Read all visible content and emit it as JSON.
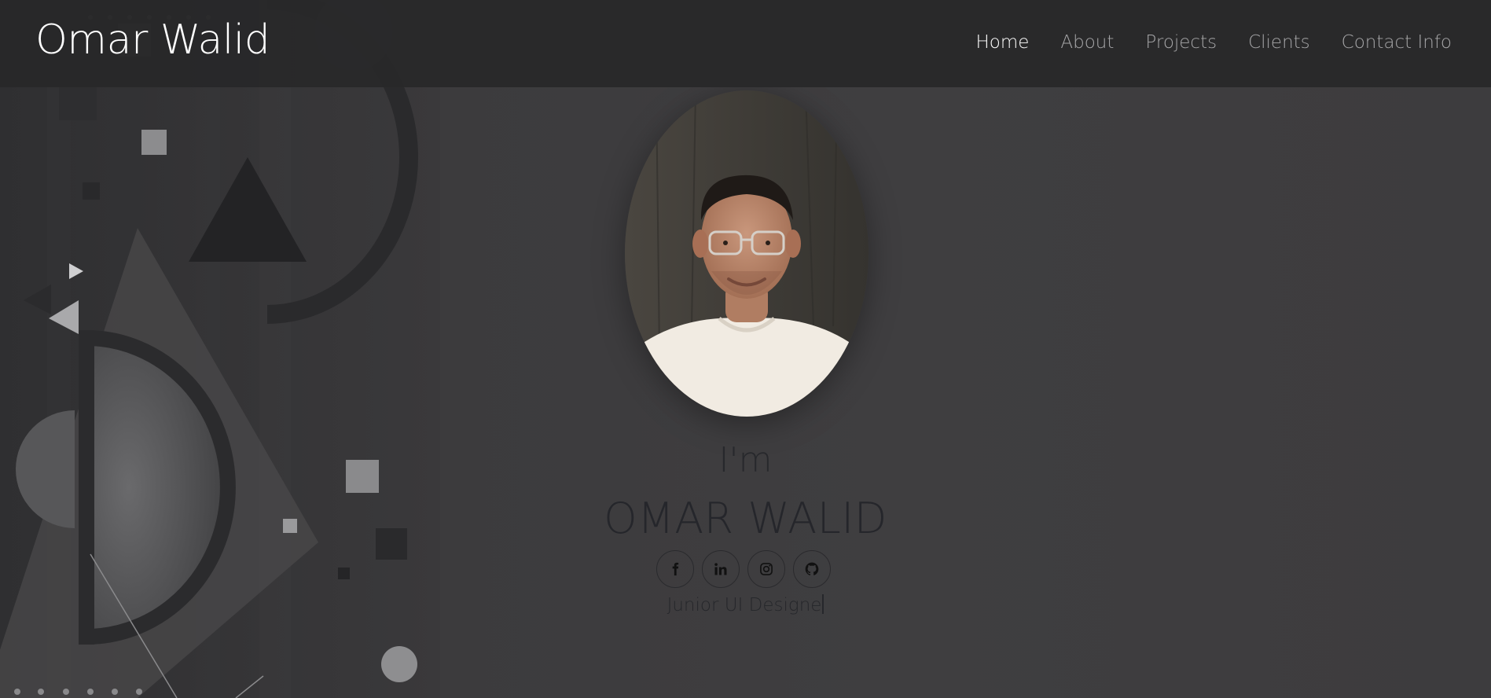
{
  "brand": "Omar Walid",
  "nav": {
    "items": [
      {
        "label": "Home",
        "active": true
      },
      {
        "label": "About",
        "active": false
      },
      {
        "label": "Projects",
        "active": false
      },
      {
        "label": "Clients",
        "active": false
      },
      {
        "label": "Contact Info",
        "active": false
      }
    ]
  },
  "hero": {
    "intro": "I'm",
    "name": "OMAR WALID",
    "role_typed": "Junior UI Designe",
    "socials": [
      {
        "icon": "facebook-icon"
      },
      {
        "icon": "linkedin-icon"
      },
      {
        "icon": "instagram-icon"
      },
      {
        "icon": "github-icon"
      }
    ]
  },
  "colors": {
    "background": "#3c3b3d",
    "navbar": "#282829",
    "nav_text": "#a6a6a8",
    "nav_active": "#ffffff",
    "hero_text": "#26272b"
  }
}
